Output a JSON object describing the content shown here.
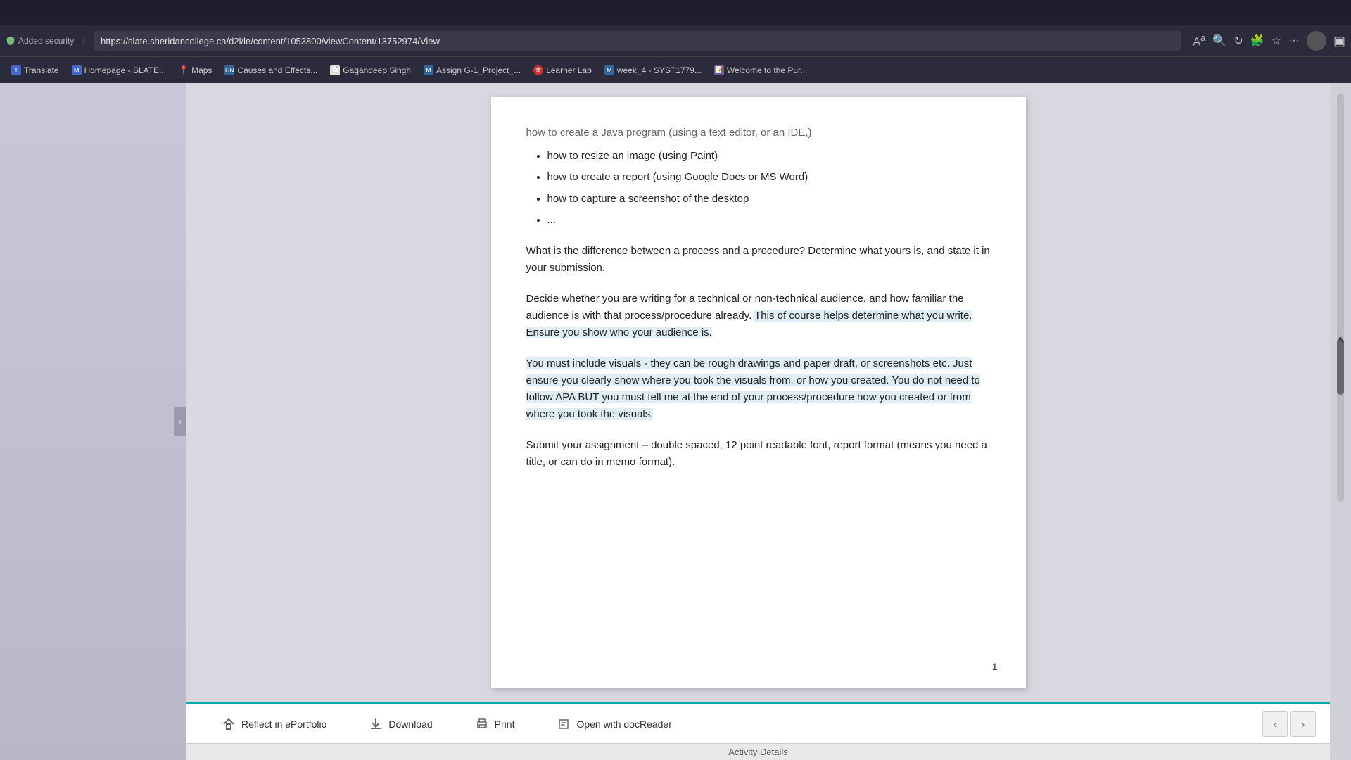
{
  "browser": {
    "security_label": "Added security",
    "url": "https://slate.sheridancollege.ca/d2l/le/content/1053800/viewContent/13752974/View",
    "separator": "|"
  },
  "bookmarks": [
    {
      "id": "translate",
      "label": "Translate",
      "icon_class": "bm-translate",
      "icon_text": "T"
    },
    {
      "id": "homepage",
      "label": "Homepage - SLATE...",
      "icon_class": "bm-homepage",
      "icon_text": "M"
    },
    {
      "id": "maps",
      "label": "Maps",
      "icon_text": "📍",
      "icon_class": ""
    },
    {
      "id": "causes",
      "label": "Causes and Effects...",
      "icon_class": "bm-causes",
      "icon_text": "UN"
    },
    {
      "id": "gagandeep",
      "label": "Gagandeep Singh",
      "icon_class": "bm-gagandeep",
      "icon_text": "📄"
    },
    {
      "id": "assign",
      "label": "Assign G-1_Project_...",
      "icon_class": "bm-assign",
      "icon_text": "M"
    },
    {
      "id": "learnerlab",
      "label": "Learner Lab",
      "icon_class": "bm-learnerlab",
      "icon_text": "❀"
    },
    {
      "id": "week4",
      "label": "week_4 - SYST1779...",
      "icon_class": "bm-week4",
      "icon_text": "M"
    },
    {
      "id": "welcome",
      "label": "Welcome to the Pur...",
      "icon_class": "bm-welcome",
      "icon_text": "📝"
    }
  ],
  "document": {
    "partial_top_line": "how to create a Java program (using a text editor, or an IDE,)",
    "bullet_items": [
      "how to resize an image (using Paint)",
      "how to create a report (using Google Docs or MS Word)",
      "how to capture a screenshot of the desktop",
      "..."
    ],
    "paragraph1": "What is the difference between a process and a procedure?  Determine what yours is, and state it in your submission.",
    "paragraph2": "Decide whether you are writing for a technical or non-technical audience, and how familiar the audience is with that process/procedure already. This of course helps determine what you write. Ensure you show who your audience is.",
    "paragraph3": "You must include visuals -  they can be rough drawings and paper draft, or screenshots etc. Just ensure you clearly show where you took the visuals from, or how you created.  You do not need to follow APA BUT you must tell me at the end of your process/procedure how you created or from where you took the visuals.",
    "paragraph4": "Submit your assignment – double spaced, 12 point readable font, report format (means you need a title, or can do in memo format).",
    "page_number": "1"
  },
  "toolbar": {
    "reflect_label": "Reflect in ePortfolio",
    "download_label": "Download",
    "print_label": "Print",
    "open_docreader_label": "Open with docReader",
    "prev_arrow": "‹",
    "next_arrow": "›"
  },
  "activity_bar": {
    "label": "Activity Details"
  }
}
